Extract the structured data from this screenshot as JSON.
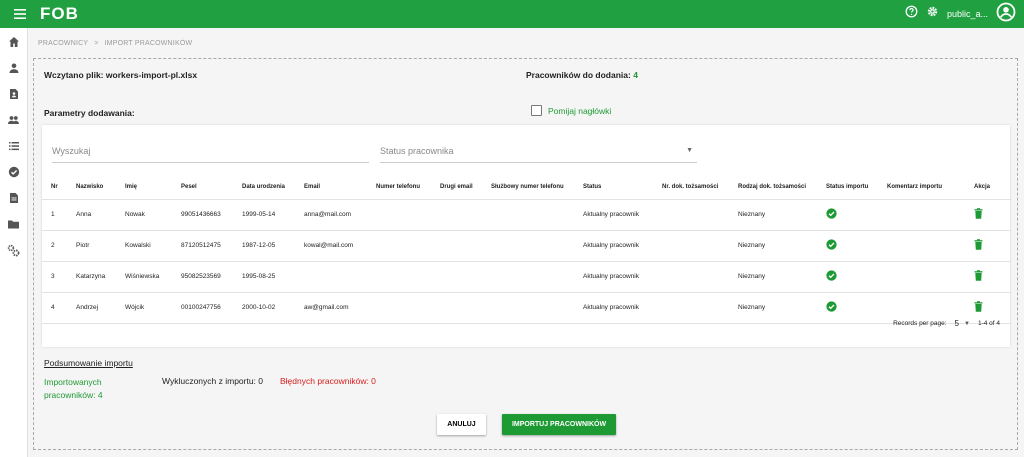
{
  "app": {
    "logo": "FOB",
    "username": "public_a..."
  },
  "breadcrumb": {
    "parent": "PRACOWNICY",
    "separator": ">",
    "current": "IMPORT PRACOWNIKÓW"
  },
  "file": {
    "label": "Wczytano plik:",
    "name": "workers-import-pl.xlsx"
  },
  "to_add": {
    "label": "Pracowników do dodania:",
    "count": "4"
  },
  "params": {
    "label": "Parametry dodawania:",
    "skip_headers_label": "Pomijaj nagłówki",
    "skip_headers_checked": false
  },
  "filters": {
    "search_placeholder": "Wyszukaj",
    "status_placeholder": "Status pracownika"
  },
  "table": {
    "headers": [
      "Nr",
      "Nazwisko",
      "Imię",
      "Pesel",
      "Data urodzenia",
      "Email",
      "Numer telefonu",
      "Drugi email",
      "Służbowy numer telefonu",
      "Status",
      "Nr. dok. tożsamości",
      "Rodzaj dok. tożsamości",
      "Status importu",
      "Komentarz importu",
      "Akcja"
    ],
    "rows": [
      {
        "nr": "1",
        "nazwisko": "Anna",
        "imie": "Nowak",
        "pesel": "99051436663",
        "data": "1999-05-14",
        "email": "anna@mail.com",
        "telefon": "",
        "drugi_email": "",
        "sluzbowy": "",
        "status": "Aktualny pracownik",
        "nr_dok": "",
        "rodzaj_dok": "Nieznany",
        "status_importu": "ok",
        "komentarz": ""
      },
      {
        "nr": "2",
        "nazwisko": "Piotr",
        "imie": "Kowalski",
        "pesel": "87120512475",
        "data": "1987-12-05",
        "email": "kowal@mail.com",
        "telefon": "",
        "drugi_email": "",
        "sluzbowy": "",
        "status": "Aktualny pracownik",
        "nr_dok": "",
        "rodzaj_dok": "Nieznany",
        "status_importu": "ok",
        "komentarz": ""
      },
      {
        "nr": "3",
        "nazwisko": "Katarzyna",
        "imie": "Wiśniewska",
        "pesel": "95082523569",
        "data": "1995-08-25",
        "email": "",
        "telefon": "",
        "drugi_email": "",
        "sluzbowy": "",
        "status": "Aktualny pracownik",
        "nr_dok": "",
        "rodzaj_dok": "Nieznany",
        "status_importu": "ok",
        "komentarz": ""
      },
      {
        "nr": "4",
        "nazwisko": "Andrzej",
        "imie": "Wójcik",
        "pesel": "00100247756",
        "data": "2000-10-02",
        "email": "aw@gmail.com",
        "telefon": "",
        "drugi_email": "",
        "sluzbowy": "",
        "status": "Aktualny pracownik",
        "nr_dok": "",
        "rodzaj_dok": "Nieznany",
        "status_importu": "ok",
        "komentarz": ""
      }
    ]
  },
  "pagination": {
    "label": "Records per page:",
    "page_size": "5",
    "range": "1-4 of 4"
  },
  "summary": {
    "title": "Podsumowanie importu",
    "imported": "Importowanych pracowników: 4",
    "excluded": "Wykluczonych z importu: 0",
    "errors": "Błędnych pracowników: 0"
  },
  "actions": {
    "cancel": "ANULUJ",
    "import": "IMPORTUJ PRACOWNIKÓW"
  },
  "colors": {
    "brand_green": "#20a040",
    "accent_green": "#1e9a34",
    "error_red": "#d81b1b"
  }
}
